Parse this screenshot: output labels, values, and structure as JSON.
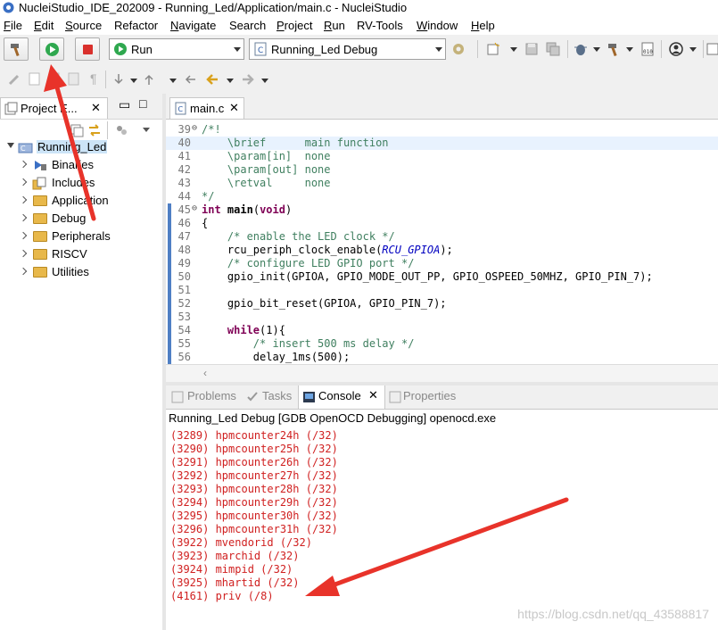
{
  "window": {
    "title": "NucleiStudio_IDE_202009 - Running_Led/Application/main.c - NucleiStudio"
  },
  "menu": [
    {
      "label": "File",
      "mnemonic": "F",
      "rest": "ile"
    },
    {
      "label": "Edit",
      "mnemonic": "E",
      "rest": "dit"
    },
    {
      "label": "Source",
      "mnemonic": "S",
      "rest": "ource"
    },
    {
      "label": "Refactor",
      "mnemonic": "",
      "rest": "Refactor"
    },
    {
      "label": "Navigate",
      "mnemonic": "N",
      "rest": "avigate"
    },
    {
      "label": "Search",
      "mnemonic": "",
      "rest": "Search"
    },
    {
      "label": "Project",
      "mnemonic": "P",
      "rest": "roject"
    },
    {
      "label": "Run",
      "mnemonic": "R",
      "rest": "un"
    },
    {
      "label": "RV-Tools",
      "mnemonic": "",
      "rest": "RV-Tools"
    },
    {
      "label": "Window",
      "mnemonic": "W",
      "rest": "indow"
    },
    {
      "label": "Help",
      "mnemonic": "H",
      "rest": "elp"
    }
  ],
  "toolbar": {
    "mode_combo": "Run",
    "config_combo": "Running_Led Debug"
  },
  "project_explorer": {
    "tab_label": "Project E...",
    "root": "Running_Led",
    "items": [
      "Binaries",
      "Includes",
      "Application",
      "Debug",
      "Peripherals",
      "RISCV",
      "Utilities"
    ]
  },
  "editor": {
    "tab_label": "main.c",
    "lines": [
      {
        "n": "39",
        "text": "/*!"
      },
      {
        "n": "40",
        "text": "    \\brief      main function"
      },
      {
        "n": "41",
        "text": "    \\param[in]  none"
      },
      {
        "n": "42",
        "text": "    \\param[out] none"
      },
      {
        "n": "43",
        "text": "    \\retval     none"
      },
      {
        "n": "44",
        "text": "*/"
      },
      {
        "n": "45",
        "text": "int main(void)"
      },
      {
        "n": "46",
        "text": "{"
      },
      {
        "n": "47",
        "text": "    /* enable the LED clock */"
      },
      {
        "n": "48",
        "text": "    rcu_periph_clock_enable(RCU_GPIOA);"
      },
      {
        "n": "49",
        "text": "    /* configure LED GPIO port */"
      },
      {
        "n": "50",
        "text": "    gpio_init(GPIOA, GPIO_MODE_OUT_PP, GPIO_OSPEED_50MHZ, GPIO_PIN_7);"
      },
      {
        "n": "51",
        "text": ""
      },
      {
        "n": "52",
        "text": "    gpio_bit_reset(GPIOA, GPIO_PIN_7);"
      },
      {
        "n": "53",
        "text": ""
      },
      {
        "n": "54",
        "text": "    while(1){"
      },
      {
        "n": "55",
        "text": "        /* insert 500 ms delay */"
      },
      {
        "n": "56",
        "text": "        delay_1ms(500);"
      }
    ]
  },
  "bottom_tabs": [
    "Problems",
    "Tasks",
    "Console",
    "Properties"
  ],
  "console": {
    "header": "Running_Led Debug [GDB OpenOCD Debugging] openocd.exe",
    "lines": [
      "(3289) hpmcounter24h (/32)",
      "(3290) hpmcounter25h (/32)",
      "(3291) hpmcounter26h (/32)",
      "(3292) hpmcounter27h (/32)",
      "(3293) hpmcounter28h (/32)",
      "(3294) hpmcounter29h (/32)",
      "(3295) hpmcounter30h (/32)",
      "(3296) hpmcounter31h (/32)",
      "(3922) mvendorid (/32)",
      "(3923) marchid (/32)",
      "(3924) mimpid (/32)",
      "(3925) mhartid (/32)",
      "(4161) priv (/8)"
    ]
  },
  "watermark": "https://blog.csdn.net/qq_43588817",
  "colors": {
    "annotation_arrow": "#e8332a",
    "console_text": "#d02020",
    "run_green": "#2fa84f"
  }
}
